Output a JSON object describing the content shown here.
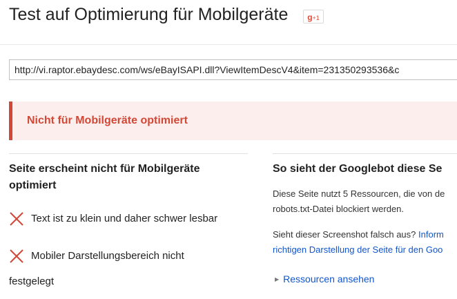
{
  "header": {
    "title": "Test auf Optimierung für Mobilgeräte",
    "gplus_label": "g+1"
  },
  "url_input": {
    "value": "http://vi.raptor.ebaydesc.com/ws/eBayISAPI.dll?ViewItemDescV4&item=231350293536&c"
  },
  "alert": {
    "text": "Nicht für Mobilgeräte optimiert",
    "color": "#d14836",
    "background": "#fdeeee"
  },
  "left_panel": {
    "heading": "Seite erscheint nicht für Mobilgeräte optimiert",
    "issues": [
      {
        "icon": "red-x-icon",
        "text": "Text ist zu klein und daher schwer lesbar"
      },
      {
        "icon": "red-x-icon",
        "text": "Mobiler Darstellungsbereich nicht"
      }
    ],
    "issue_continuation": "festgelegt"
  },
  "right_panel": {
    "heading": "So sieht der Googlebot diese Se",
    "para1_line1": "Diese Seite nutzt 5 Ressourcen, die von de",
    "para1_line2": "robots.txt-Datei blockiert werden.",
    "para2_line1_text": "Sieht dieser Screenshot falsch aus? ",
    "para2_line1_link": "Inform",
    "para2_line2_link": "richtigen Darstellung der Seite für den Goo",
    "resources_link": "Ressourcen ansehen"
  }
}
